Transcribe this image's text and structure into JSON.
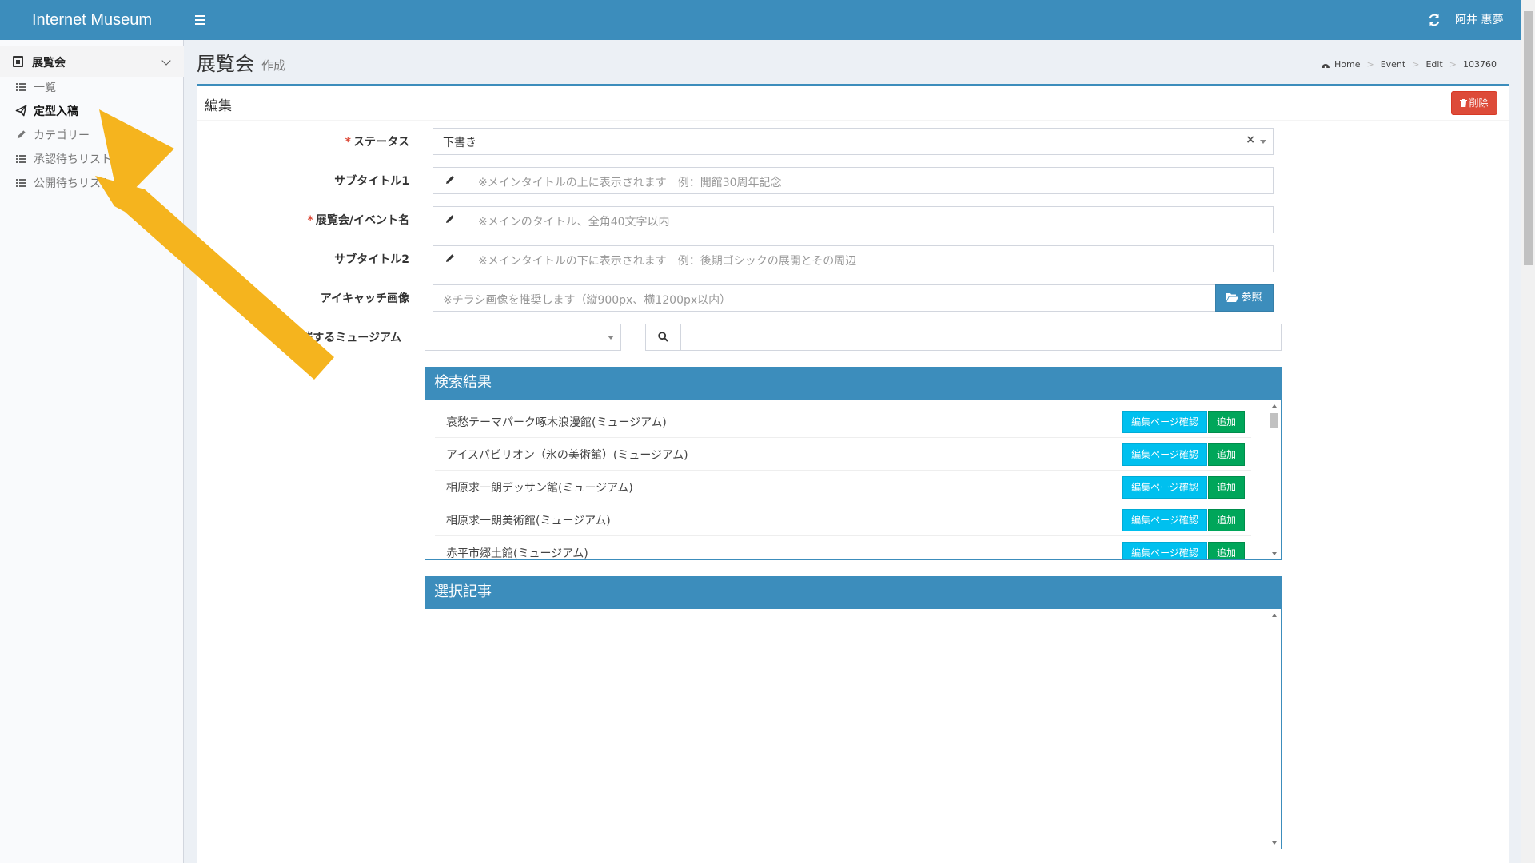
{
  "app": {
    "brand": "Internet Museum",
    "user": "阿井 惠夢"
  },
  "sidebar": {
    "section": "展覧会",
    "items": [
      {
        "label": "一覧",
        "icon": "list-icon"
      },
      {
        "label": "定型入稿",
        "icon": "paper-plane-icon",
        "active": true
      },
      {
        "label": "カテゴリー",
        "icon": "pencil-icon"
      },
      {
        "label": "承認待ちリスト",
        "icon": "list-icon"
      },
      {
        "label": "公開待ちリスト",
        "icon": "list-icon"
      }
    ]
  },
  "header": {
    "title": "展覧会",
    "subtitle": "作成",
    "breadcrumb": [
      "Home",
      "Event",
      "Edit",
      "103760"
    ]
  },
  "box": {
    "title": "編集",
    "delete_label": "削除"
  },
  "form": {
    "status": {
      "label": "ステータス",
      "required": true,
      "value": "下書き",
      "clear": "×"
    },
    "subtitle1": {
      "label": "サブタイトル1",
      "placeholder": "※メインタイトルの上に表示されます　例：開館30周年記念"
    },
    "event_name": {
      "label": "展覧会/イベント名",
      "required": true,
      "placeholder": "※メインのタイトル、全角40文字以内"
    },
    "subtitle2": {
      "label": "サブタイトル2",
      "placeholder": "※メインタイトルの下に表示されます　例：後期ゴシックの展開とその周辺"
    },
    "eyecatch": {
      "label": "アイキャッチ画像",
      "placeholder": "※チラシ画像を推奨します（縦900px、横1200px以内）",
      "button": "参照"
    },
    "museum": {
      "label": "開催するミュージアム",
      "label_visible_part": "るミュージアム"
    }
  },
  "search_results": {
    "title": "検索結果",
    "check_label": "編集ページ確認",
    "add_label": "追加",
    "items": [
      "哀愁テーマパーク啄木浪漫館(ミュージアム)",
      "アイスパビリオン（氷の美術館）(ミュージアム)",
      "相原求一朗デッサン館(ミュージアム)",
      "相原求一朗美術館(ミュージアム)",
      "赤平市郷土館(ミュージアム)"
    ]
  },
  "selected": {
    "title": "選択記事"
  },
  "colors": {
    "primary": "#3c8dbc",
    "danger": "#dd4b39",
    "info": "#00c0ef",
    "success": "#00a65a",
    "annotation_arrow": "#f5b41e"
  }
}
